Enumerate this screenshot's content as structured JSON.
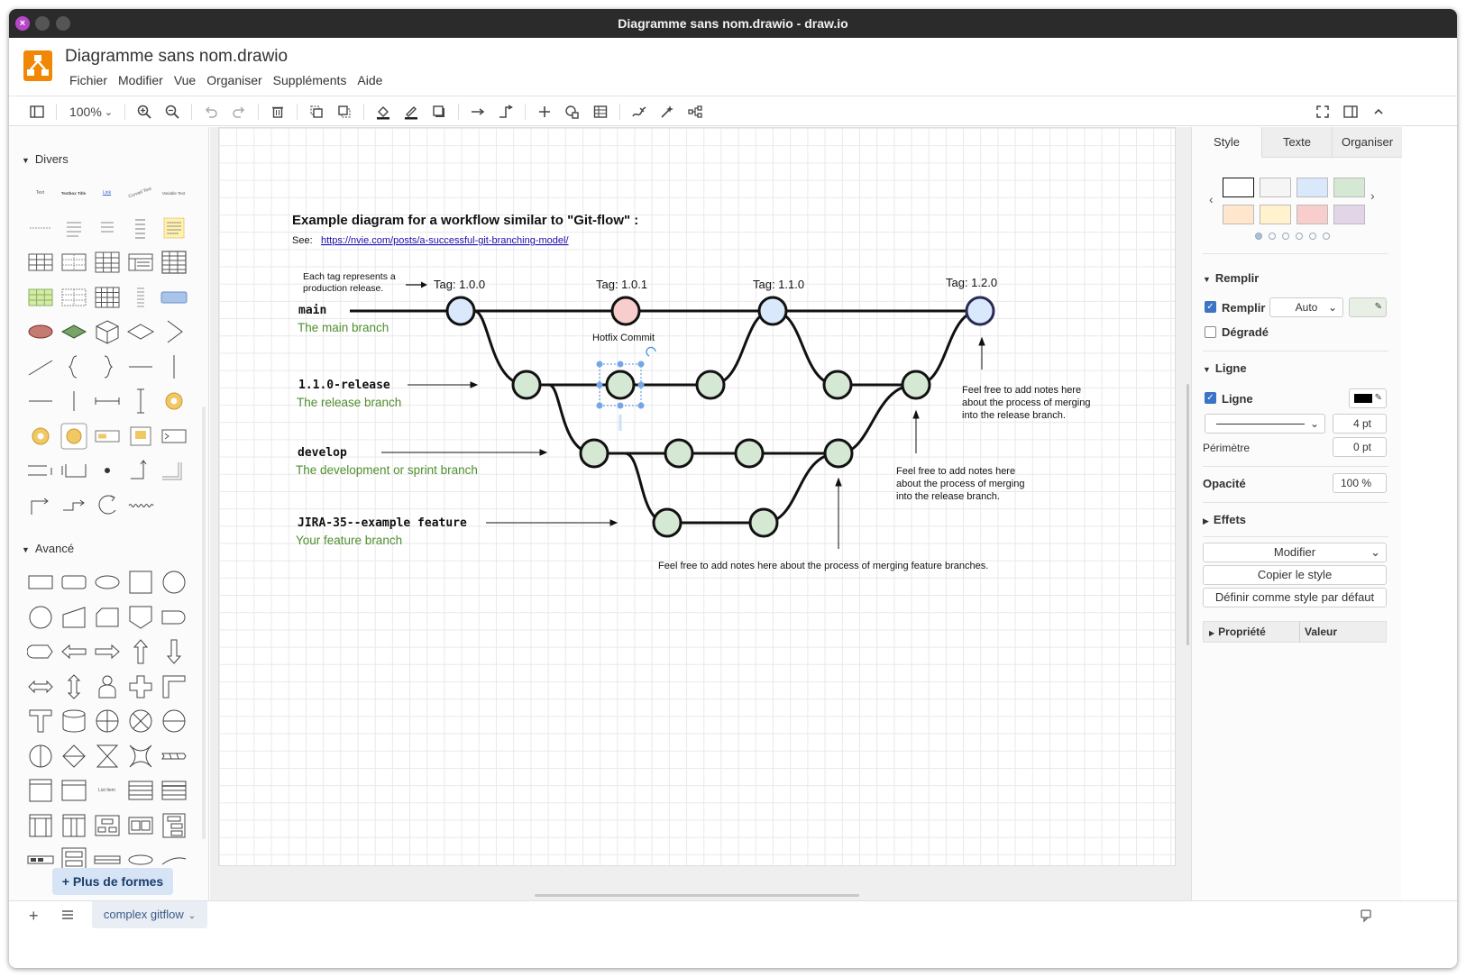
{
  "window": {
    "title": "Diagramme sans nom.drawio - draw.io",
    "close_glyph": "×"
  },
  "header": {
    "doc_title": "Diagramme sans nom.drawio",
    "menu": [
      "Fichier",
      "Modifier",
      "Vue",
      "Organiser",
      "Suppléments",
      "Aide"
    ]
  },
  "toolbar": {
    "zoom": "100%",
    "zoom_caret": "⌄"
  },
  "left_panel": {
    "section_misc": "Divers",
    "section_advanced": "Avancé",
    "more_shapes": "+ Plus de formes",
    "misc_thumb_labels": [
      "Text",
      "Textbox Title",
      "Link",
      "Curved Text",
      "Variable Text",
      "List Item"
    ]
  },
  "diagram": {
    "title": "Example diagram for a workflow similar to \"Git-flow\" :",
    "see_label": "See:",
    "link": "https://nvie.com/posts/a-successful-git-branching-model/",
    "tag_note_line1": "Each tag represents a",
    "tag_note_line2": "production release.",
    "tags": [
      "Tag: 1.0.0",
      "Tag: 1.0.1",
      "Tag: 1.1.0",
      "Tag: 1.2.0"
    ],
    "hotfix_label": "Hotfix Commit",
    "branches": [
      {
        "name": "main",
        "desc": "The main branch"
      },
      {
        "name": "1.1.0-release",
        "desc": "The release branch"
      },
      {
        "name": "develop",
        "desc": "The development or sprint branch"
      },
      {
        "name": "JIRA-35--example feature",
        "desc": "Your feature branch"
      }
    ],
    "note_release_top": [
      "Feel free to add notes here",
      "about the process of merging",
      "into the release branch."
    ],
    "note_release_mid": [
      "Feel free to add notes here",
      "about the process of merging",
      "into the release branch."
    ],
    "note_feature": "Feel free to add notes here about the process of merging feature branches.",
    "colors": {
      "blue_node": "#dae8fc",
      "red_node": "#f8cecc",
      "green_node": "#d5e8d4",
      "branch_desc": "#4e8f2d",
      "link": "#1a0dab"
    }
  },
  "right_panel": {
    "tabs": [
      "Style",
      "Texte",
      "Organiser"
    ],
    "swatch_colors": [
      "#ffffff",
      "#f5f5f5",
      "#dae8fc",
      "#d5e8d4",
      "#ffe6cc",
      "#fff2cc",
      "#f8cecc",
      "#e1d5e7"
    ],
    "fill_section": "Remplir",
    "fill_label": "Remplir",
    "fill_mode": "Auto",
    "gradient_label": "Dégradé",
    "line_section": "Ligne",
    "line_label": "Ligne",
    "line_width": "4 pt",
    "perimeter_label": "Périmètre",
    "perimeter_value": "0 pt",
    "opacity_label": "Opacité",
    "opacity_value": "100 %",
    "effects_label": "Effets",
    "edit_select": "Modifier",
    "copy_style": "Copier le style",
    "set_default": "Définir comme style par défaut",
    "prop_col": "Propriété",
    "value_col": "Valeur"
  },
  "footer": {
    "page_tab": "complex gitflow"
  }
}
